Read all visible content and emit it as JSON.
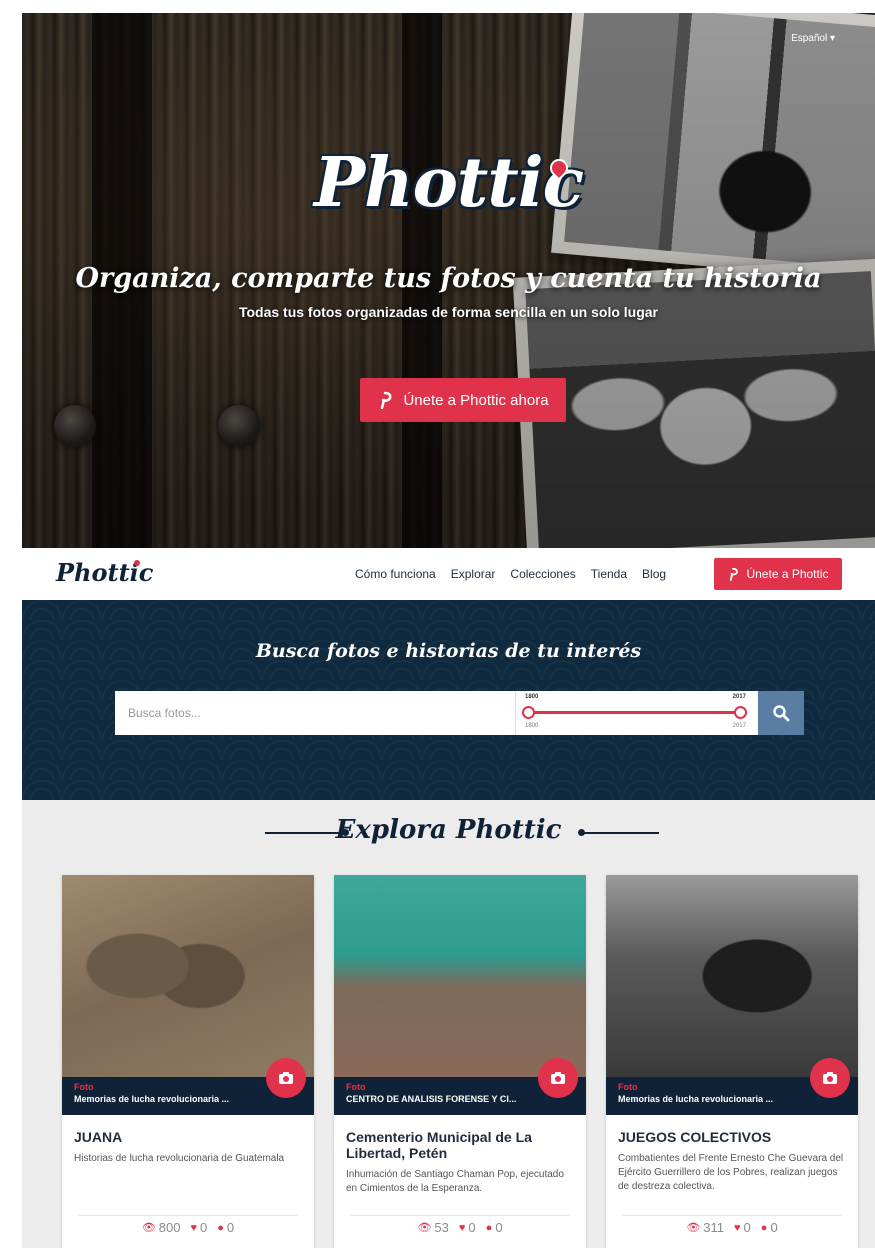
{
  "hero": {
    "language": "Español ▾",
    "logo": "Phottic",
    "tagline": "Organiza, comparte tus fotos y cuenta tu historia",
    "subtitle": "Todas tus fotos organizadas de forma sencilla en un solo lugar",
    "cta_label": "Únete a Phottic ahora"
  },
  "navbar": {
    "logo": "Phottic",
    "links": [
      "Cómo funciona",
      "Explorar",
      "Colecciones",
      "Tienda",
      "Blog"
    ],
    "cta_label": "Únete a Phottic"
  },
  "search": {
    "title": "Busca fotos e historias de tu interés",
    "placeholder": "Busca fotos...",
    "range_from": "1800",
    "range_to": "2017",
    "range_min": "1800",
    "range_max": "2017"
  },
  "explore": {
    "title": "Explora Phottic",
    "cards": [
      {
        "type": "Foto",
        "collection": "Memorias de lucha revolucionaria ...",
        "title": "JUANA",
        "description": "Historias de lucha revolucionaria de Guatemala",
        "views": "800",
        "likes": "0",
        "comments": "0"
      },
      {
        "type": "Foto",
        "collection": "CENTRO DE ANALISIS FORENSE Y CI...",
        "title": "Cementerio Municipal de La Libertad, Petén",
        "description": "Inhumación de Santiago Chaman Pop, ejecutado en Cimientos de la Esperanza.",
        "views": "53",
        "likes": "0",
        "comments": "0"
      },
      {
        "type": "Foto",
        "collection": "Memorias de lucha revolucionaria ...",
        "title": "JUEGOS COLECTIVOS",
        "description": "Combatientes del Frente Ernesto Che Guevara del Ejército Guerrillero de los Pobres, realizan juegos de destreza colectiva.",
        "views": "311",
        "likes": "0",
        "comments": "0"
      }
    ]
  },
  "colors": {
    "brand_red": "#e0324b",
    "navy": "#0f2238",
    "search_button": "#5a7ea3"
  }
}
